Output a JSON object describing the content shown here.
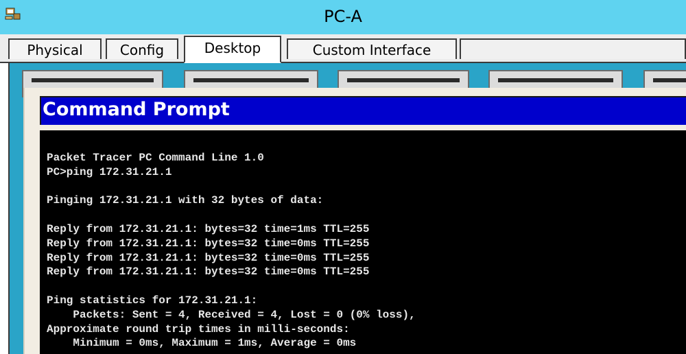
{
  "window": {
    "title": "PC-A",
    "icon": "packet-tracer-pc-icon"
  },
  "tabs": [
    {
      "label": "Physical",
      "active": false
    },
    {
      "label": "Config",
      "active": false
    },
    {
      "label": "Desktop",
      "active": true
    },
    {
      "label": "Custom Interface",
      "active": false
    }
  ],
  "cmd": {
    "title": "Command Prompt",
    "lines": [
      "Packet Tracer PC Command Line 1.0",
      "PC>ping 172.31.21.1",
      "",
      "Pinging 172.31.21.1 with 32 bytes of data:",
      "",
      "Reply from 172.31.21.1: bytes=32 time=1ms TTL=255",
      "Reply from 172.31.21.1: bytes=32 time=0ms TTL=255",
      "Reply from 172.31.21.1: bytes=32 time=0ms TTL=255",
      "Reply from 172.31.21.1: bytes=32 time=0ms TTL=255",
      "",
      "Ping statistics for 172.31.21.1:",
      "    Packets: Sent = 4, Received = 4, Lost = 0 (0% loss),",
      "Approximate round trip times in milli-seconds:",
      "    Minimum = 0ms, Maximum = 1ms, Average = 0ms"
    ]
  },
  "colors": {
    "titlebar": "#5fd3f0",
    "desktop_bg": "#2aa4c8",
    "cmd_titlebar": "#0000cc",
    "console_bg": "#000000",
    "console_text": "#e8e8e8"
  }
}
